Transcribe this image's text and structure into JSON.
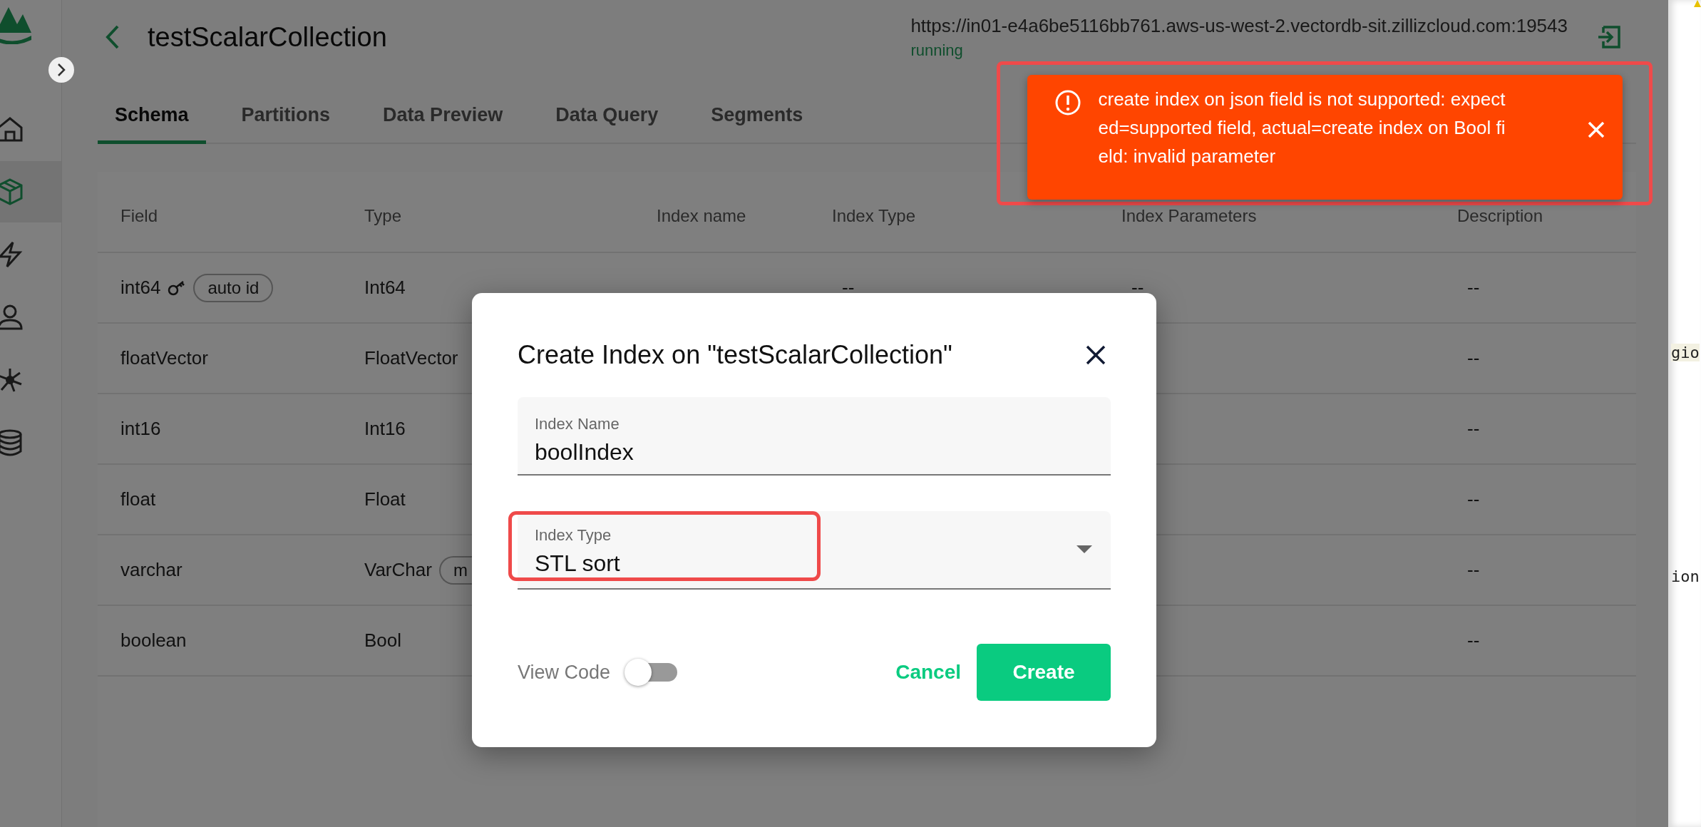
{
  "sidebar": {
    "items": [
      {
        "kind": "home",
        "selected": false
      },
      {
        "kind": "cube",
        "selected": true
      },
      {
        "kind": "bolt",
        "selected": false
      },
      {
        "kind": "user",
        "selected": false
      },
      {
        "kind": "network",
        "selected": false
      },
      {
        "kind": "database",
        "selected": false
      }
    ]
  },
  "header": {
    "title": "testScalarCollection",
    "url": "https://in01-e4a6be5116bb761.aws-us-west-2.vectordb-sit.zillizcloud.com:19543",
    "status": "running"
  },
  "tabs": [
    {
      "label": "Schema",
      "selected": true
    },
    {
      "label": "Partitions",
      "selected": false
    },
    {
      "label": "Data Preview",
      "selected": false
    },
    {
      "label": "Data Query",
      "selected": false
    },
    {
      "label": "Segments",
      "selected": false
    }
  ],
  "table": {
    "columns": [
      "Field",
      "Type",
      "Index name",
      "Index Type",
      "Index Parameters",
      "Description"
    ],
    "rows": [
      {
        "field": "int64",
        "primary_key": true,
        "tag": "auto id",
        "type": "Int64",
        "index_type": "--",
        "index_parameters": "--",
        "description": "--"
      },
      {
        "field": "floatVector",
        "primary_key": false,
        "type": "FloatVector",
        "description": "--"
      },
      {
        "field": "int16",
        "primary_key": false,
        "type": "Int16",
        "description": "--"
      },
      {
        "field": "float",
        "primary_key": false,
        "type": "Float",
        "description": "--"
      },
      {
        "field": "varchar",
        "primary_key": false,
        "type": "VarChar",
        "type_tag": "m",
        "description": "--"
      },
      {
        "field": "boolean",
        "primary_key": false,
        "type": "Bool",
        "description": "--"
      }
    ]
  },
  "modal": {
    "title": "Create Index on \"testScalarCollection\"",
    "fields": [
      {
        "kind": "text",
        "label": "Index Name",
        "value": "boolIndex",
        "highlighted": false
      },
      {
        "kind": "select",
        "label": "Index Type",
        "value": "STL sort",
        "highlighted": true
      }
    ],
    "view_code": {
      "label": "View Code",
      "on": false
    },
    "cancel": "Cancel",
    "submit": "Create"
  },
  "toast": {
    "message": "create index on json field is not supported: expected=supported field, actual=create index on Bool field: invalid parameter",
    "highlighted": true
  },
  "side_strip": {
    "lines": [
      "gio",
      "ion"
    ]
  }
}
